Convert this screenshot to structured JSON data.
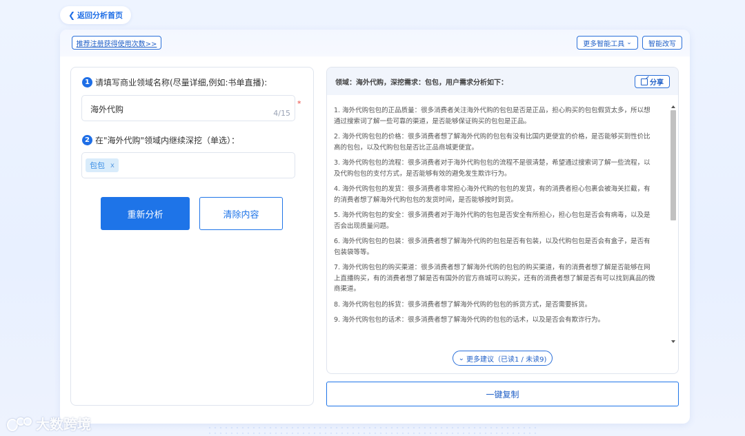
{
  "nav": {
    "back_label": "返回分析首页"
  },
  "header": {
    "recommend_label": "推荐注册获得使用次数>>",
    "tools_label": "更多智能工具",
    "rewrite_label": "智能改写"
  },
  "form": {
    "step1_number": "1",
    "step1_label": "请填写商业领域名称(尽量详细,例如:书单直播):",
    "domain_value": "海外代购",
    "char_counter": "4/15",
    "required_mark": "*",
    "step2_number": "2",
    "step2_label": "在\"海外代购\"领域内继续深挖（单选）：",
    "selected_tag": "包包",
    "tag_remove": "x",
    "reanalyze_label": "重新分析",
    "clear_label": "清除内容"
  },
  "result": {
    "header_text": "领域：海外代购，深挖需求：包包，用户需求分析如下：",
    "share_label": "分享",
    "items": [
      "1. 海外代购包包的正品质量：很多消费者关注海外代购的包包是否是正品，担心购买的包包假货太多，所以想通过搜索词了解一些可靠的渠道，是否能够保证购买的包包是正品。",
      "2. 海外代购包包的价格：很多消费者想了解海外代购的包包有没有比国内更便宜的价格，是否能够买到性价比高的包包，以及代购包包是否比正品商城更便宜。",
      "3. 海外代购包包的流程：很多消费者对于海外代购包包的流程不是很清楚，希望通过搜索词了解一些流程，以及代购包包的支付方式，是否能够有效的避免发生欺诈行为。",
      "4. 海外代购包包的发货：很多消费者非常担心海外代购的包包的发货，有的消费者担心包裹会被海关拦截，有的消费者想了解海外代购包包的发货时间，是否能够按时到货。",
      "5. 海外代购包包的安全：很多消费者对于海外代购的包包是否安全有所担心，担心包包是否会有病毒，以及是否会出现质量问题。",
      "6. 海外代购包包的包装：很多消费者想了解海外代购的包包是否有包装，以及代购包包是否会有盒子，是否有包装袋等等。",
      "7. 海外代购包包的购买渠道：很多消费者想了解海外代购的包包的购买渠道，有的消费者想了解是否能够在网上直播购买，有的消费者想了解是否有国外的官方商城可以购买，还有的消费者想了解是否有可以找到真品的微商渠道。",
      "8. 海外代购包包的拆货：很多消费者想了解海外代购的包包的拆货方式，是否需要拆货。",
      "9. 海外代购包包的话术：很多消费者想了解海外代购的包包的话术，以及是否会有欺诈行为。"
    ],
    "more_label": "更多建议（已读1 / 未读9)",
    "copy_label": "一键复制"
  },
  "icons": {
    "back": "chevron-left-icon",
    "tools": "chevron-down-icon",
    "share": "share-icon",
    "more": "chevron-down-icon"
  },
  "watermark": {
    "text": "大数跨境"
  },
  "colors": {
    "accent": "#1e74e8",
    "tag_bg": "#d9ecfb",
    "required": "#e8453c"
  }
}
